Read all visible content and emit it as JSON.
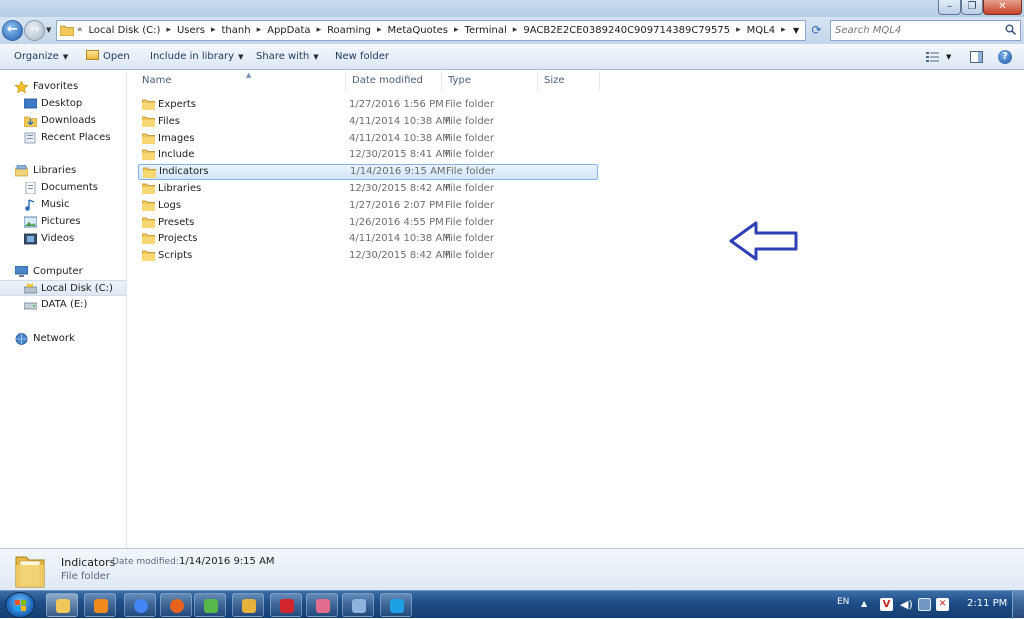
{
  "window": {
    "buttons": [
      "minimize",
      "maximize",
      "close"
    ],
    "accent": "#3b6ea8"
  },
  "address": {
    "overflow_glyph": "«",
    "crumbs": [
      "Local Disk (C:)",
      "Users",
      "thanh",
      "AppData",
      "Roaming",
      "MetaQuotes",
      "Terminal",
      "9ACB2E2CE0389240C909714389C79575",
      "MQL4"
    ],
    "search_placeholder": "Search MQL4"
  },
  "commands": {
    "organize": "Organize",
    "open": "Open",
    "include_library": "Include in library",
    "share_with": "Share with",
    "new_folder": "New folder"
  },
  "nav": {
    "favorites": "Favorites",
    "desktop": "Desktop",
    "downloads": "Downloads",
    "recent": "Recent Places",
    "libraries": "Libraries",
    "documents": "Documents",
    "music": "Music",
    "pictures": "Pictures",
    "videos": "Videos",
    "computer": "Computer",
    "local_disk": "Local Disk (C:)",
    "data_drive": "DATA (E:)",
    "network": "Network"
  },
  "columns": {
    "name": "Name",
    "date": "Date modified",
    "type": "Type",
    "size": "Size"
  },
  "files": [
    {
      "name": "Experts",
      "date": "1/27/2016 1:56 PM",
      "type": "File folder"
    },
    {
      "name": "Files",
      "date": "4/11/2014 10:38 AM",
      "type": "File folder"
    },
    {
      "name": "Images",
      "date": "4/11/2014 10:38 AM",
      "type": "File folder"
    },
    {
      "name": "Include",
      "date": "12/30/2015 8:41 AM",
      "type": "File folder"
    },
    {
      "name": "Indicators",
      "date": "1/14/2016 9:15 AM",
      "type": "File folder",
      "selected": true
    },
    {
      "name": "Libraries",
      "date": "12/30/2015 8:42 AM",
      "type": "File folder"
    },
    {
      "name": "Logs",
      "date": "1/27/2016 2:07 PM",
      "type": "File folder"
    },
    {
      "name": "Presets",
      "date": "1/26/2016 4:55 PM",
      "type": "File folder"
    },
    {
      "name": "Projects",
      "date": "4/11/2014 10:38 AM",
      "type": "File folder"
    },
    {
      "name": "Scripts",
      "date": "12/30/2015 8:42 AM",
      "type": "File folder"
    }
  ],
  "details": {
    "name": "Indicators",
    "modified_label": "Date modified:",
    "modified_value": "1/14/2016 9:15 AM",
    "type": "File folder"
  },
  "tray": {
    "lang": "EN",
    "time": "2:11 PM"
  },
  "taskbar": {
    "apps": [
      "explorer-icon",
      "media-player-icon",
      "chrome-icon",
      "firefox-icon",
      "app-green-icon",
      "app-yellow-icon",
      "app-red-icon",
      "app-pink-icon",
      "dashboard-icon",
      "skype-icon"
    ]
  }
}
